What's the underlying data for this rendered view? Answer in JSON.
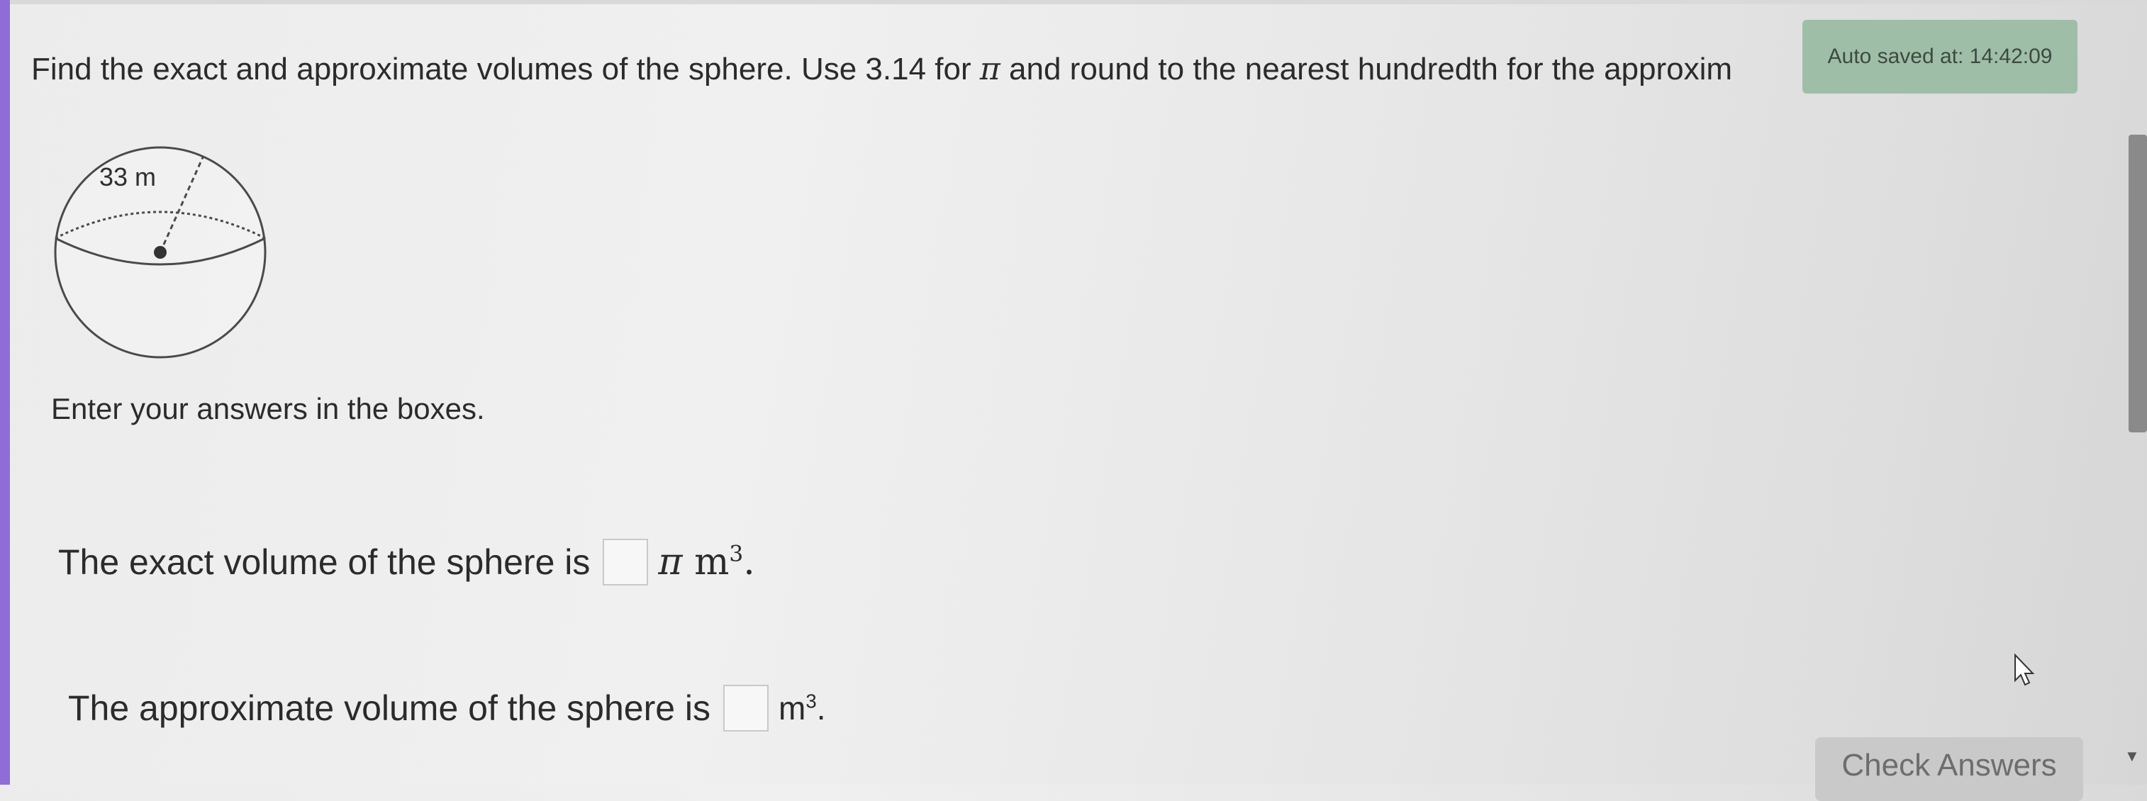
{
  "question": {
    "prefix": "Find the exact and approximate volumes of the sphere. Use 3.14 for",
    "pi_symbol": "π",
    "suffix": "and round to the nearest hundredth for the approxim"
  },
  "autosave": {
    "label": "Auto saved at: 14:42:09"
  },
  "figure": {
    "radius_label": "33 m"
  },
  "instructions": "Enter your answers in the boxes.",
  "exact": {
    "label": "The exact volume of the sphere is",
    "pi_symbol": "π",
    "unit": "m",
    "exponent": "3",
    "period": "."
  },
  "approx": {
    "label": "The approximate volume of the sphere is",
    "unit": "m",
    "exponent": "3",
    "period": "."
  },
  "check_button": {
    "label": "Check Answers"
  }
}
